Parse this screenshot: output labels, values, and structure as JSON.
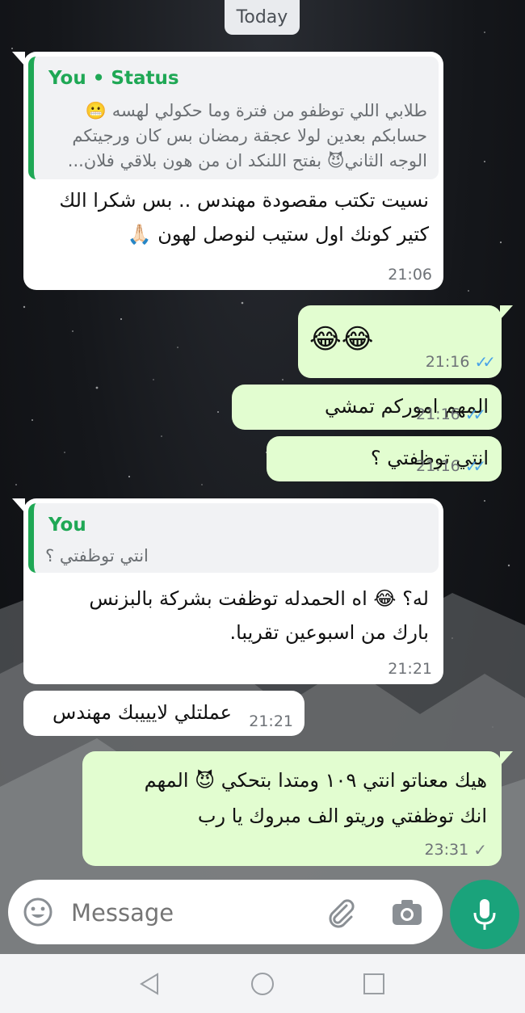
{
  "date_chip": "Today",
  "messages": [
    {
      "direction": "incoming",
      "quote": {
        "author": "You • Status",
        "lines": [
          "طلابي اللي توظفو من فترة وما حكولي لهسه 😬",
          "حسابكم بعدين لولا عجقة رمضان بس كان ورجيتكم",
          "الوجه الثاني😈 بفتح اللنكد ان من هون بلاقي فلان..."
        ]
      },
      "lines": [
        "نسيت تكتب مقصودة مهندس .. بس شكرا الك",
        "كتير كونك اول ستيب لنوصل لهون 🙏🏻"
      ],
      "time": "21:06"
    },
    {
      "direction": "outgoing",
      "text": "😂😂",
      "time": "21:16",
      "status": "read"
    },
    {
      "direction": "outgoing",
      "text": "المهم اموركم تمشي",
      "time": "21:16",
      "status": "read"
    },
    {
      "direction": "outgoing",
      "text": "انتي توظفتي ؟",
      "time": "21:16",
      "status": "read"
    },
    {
      "direction": "incoming",
      "quote": {
        "author": "You",
        "lines": [
          "انتي توظفتي ؟"
        ]
      },
      "lines": [
        "له؟ 😂 اه الحمدله توظفت بشركة بالبزنس",
        "بارك من اسبوعين تقريبا."
      ],
      "time": "21:21"
    },
    {
      "direction": "incoming",
      "text": "عملتلي لايييبك مهندس",
      "time": "21:21"
    },
    {
      "direction": "outgoing",
      "lines": [
        "هيك معناتو انتي ١٠٩ ومتدا بتحكي 😈 المهم",
        "انك توظفتي وريتو الف مبروك يا رب"
      ],
      "time": "23:31",
      "status": "sent"
    }
  ],
  "composer": {
    "placeholder": "Message",
    "icons": [
      "emoji-icon",
      "attach-icon",
      "camera-icon",
      "mic-icon"
    ]
  },
  "nav": [
    "back-icon",
    "home-icon",
    "recents-icon"
  ],
  "colors": {
    "outgoing_bubble": "#e2fdd0",
    "incoming_bubble": "#ffffff",
    "accent": "#1fa855",
    "read_ticks": "#4aa3e8",
    "mic_button": "#1aa37b"
  }
}
